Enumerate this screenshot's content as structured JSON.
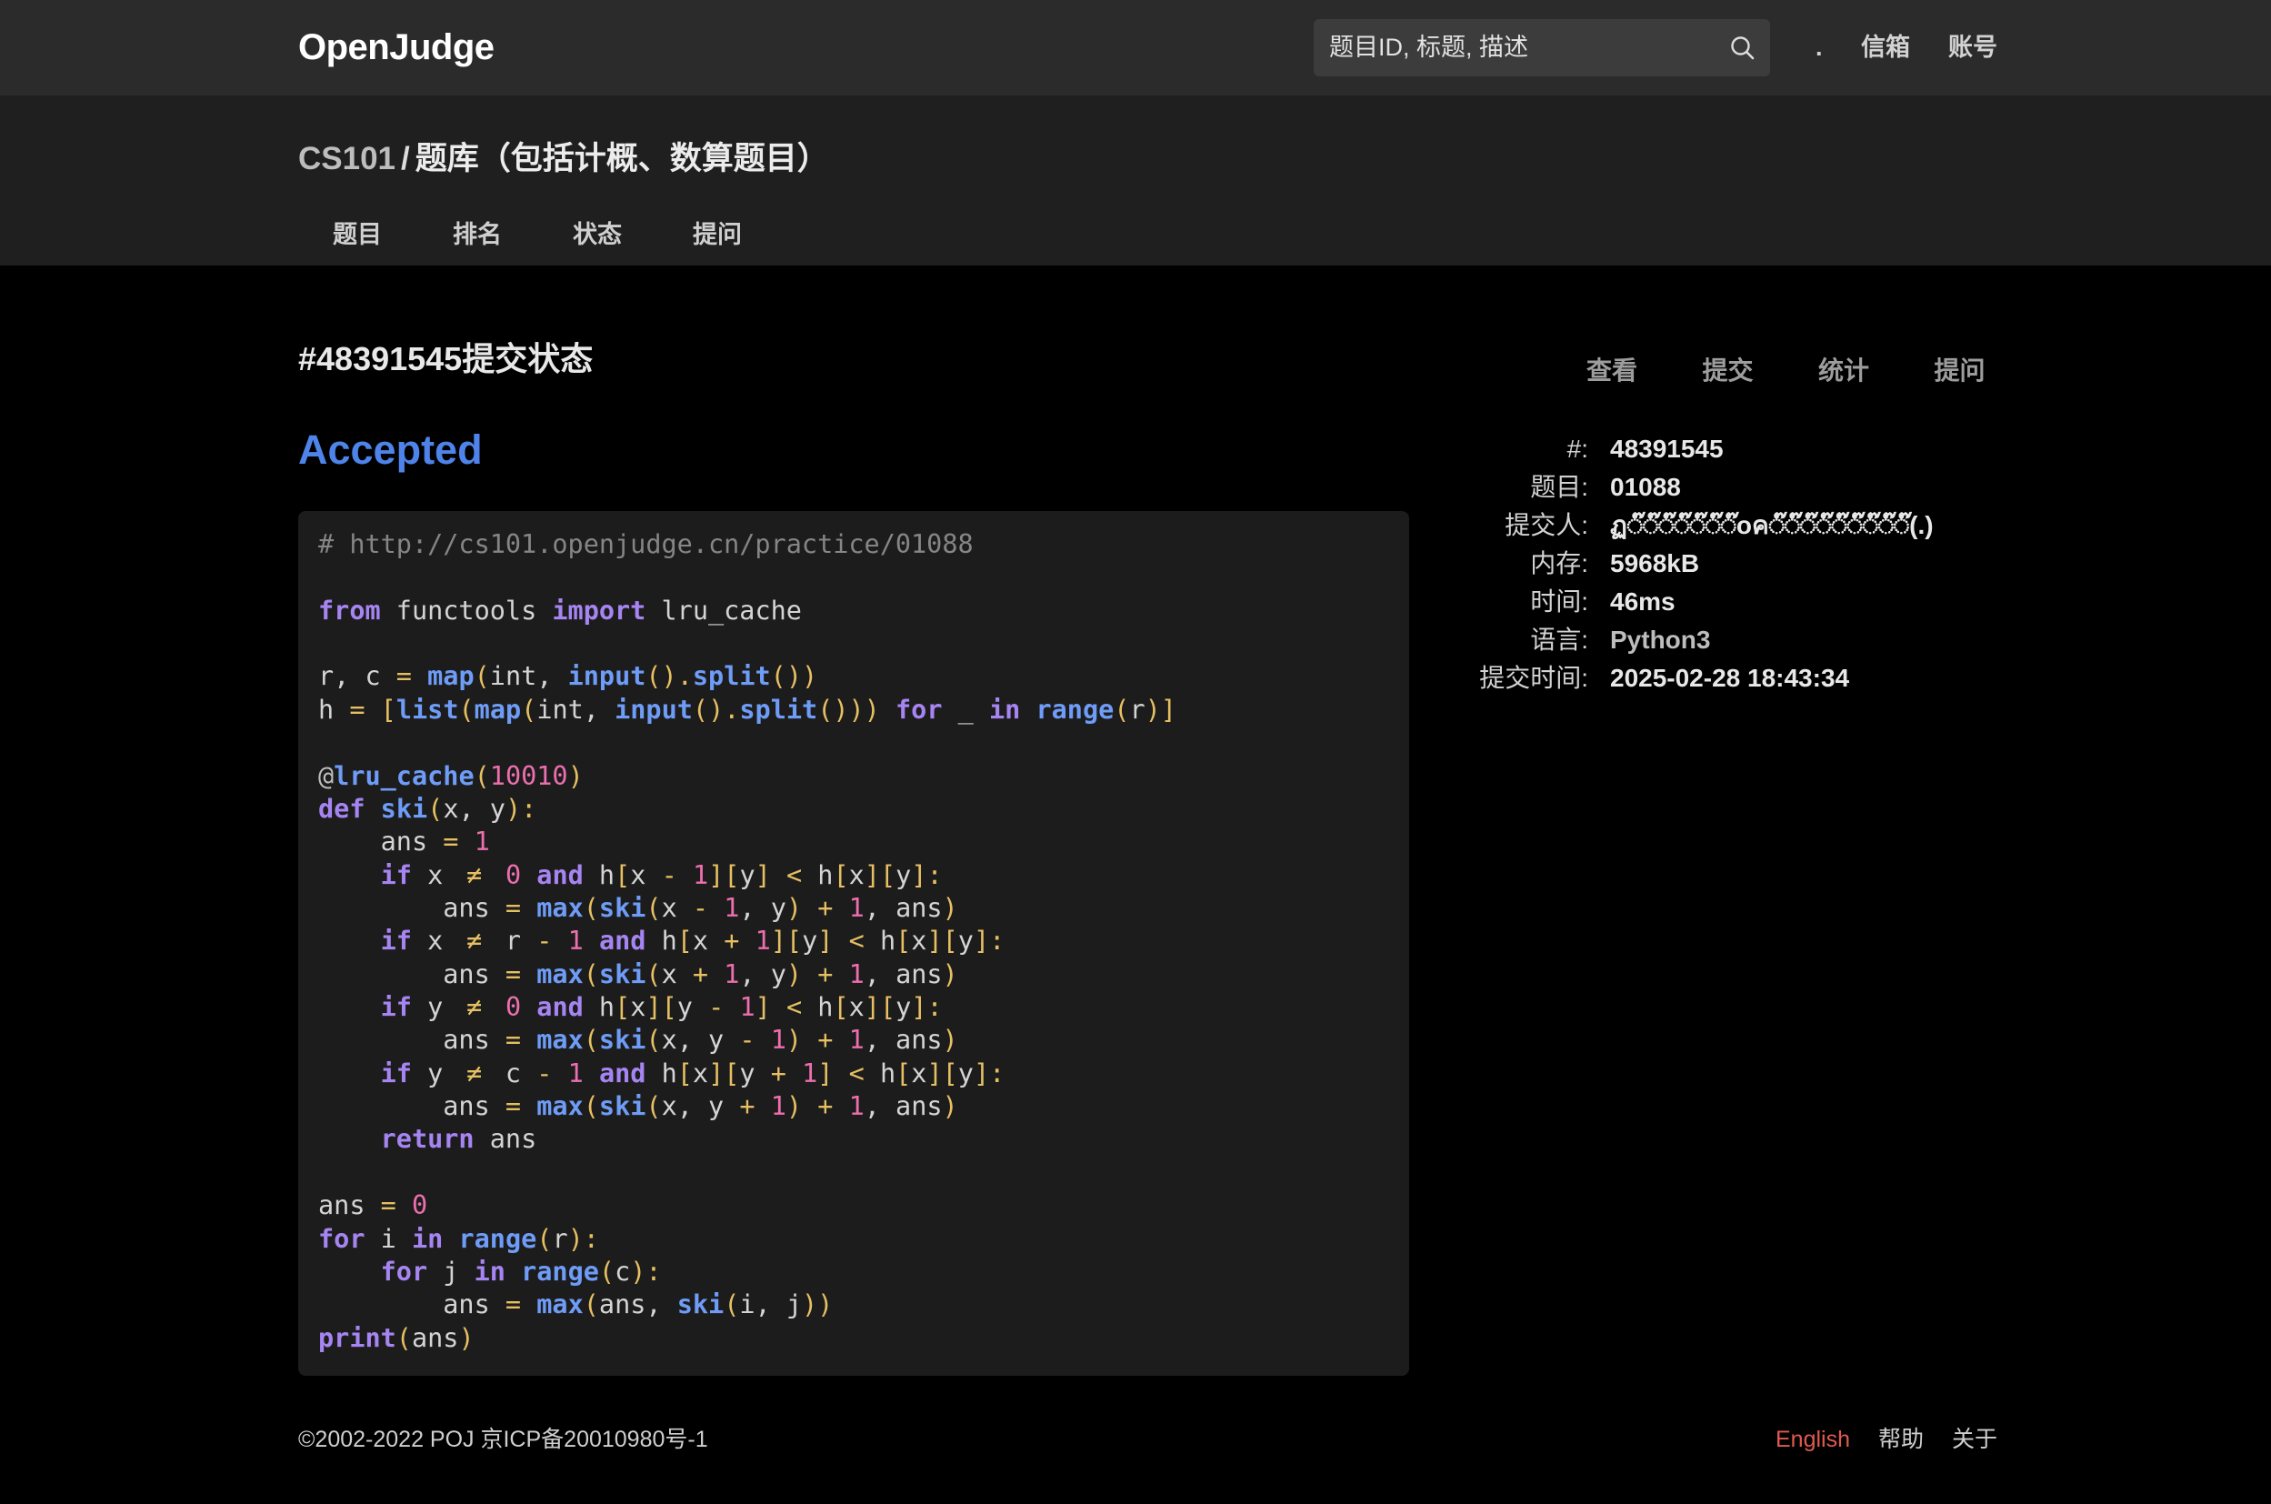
{
  "header": {
    "logo": "OpenJudge",
    "search": {
      "placeholder": "题目ID, 标题, 描述",
      "value": "",
      "icon": "search-icon"
    },
    "nav": {
      "dot": ".",
      "inbox": "信箱",
      "account": "账号"
    }
  },
  "subheader": {
    "course": "CS101",
    "separator": "/",
    "bank": "题库（包括计概、数算题目）",
    "tabs": [
      "题目",
      "排名",
      "状态",
      "提问"
    ]
  },
  "submission": {
    "title": "#48391545提交状态",
    "status": "Accepted"
  },
  "sidebar": {
    "tabs": [
      "查看",
      "提交",
      "统计",
      "提问"
    ],
    "info": [
      {
        "label": "#:",
        "value": "48391545"
      },
      {
        "label": "题目:",
        "value": "01088"
      },
      {
        "label": "提交人:",
        "value": "ฏ◌๊◌๊◌๊◌๊◌๊◌๊◌๊oค◌๊◌๊◌๊◌๊◌๊◌๊◌๊◌๊◌๊(.)"
      },
      {
        "label": "内存:",
        "value": "5968kB"
      },
      {
        "label": "时间:",
        "value": "46ms"
      },
      {
        "label": "语言:",
        "value": "Python3"
      },
      {
        "label": "提交时间:",
        "value": "2025-02-28 18:43:34"
      }
    ]
  },
  "colors": {
    "status_accepted": "#4e84ea",
    "english_link": "#e05a4e",
    "keyword": "#a685f2",
    "builtin": "#6e9cf7",
    "number": "#ec6fae",
    "operator": "#e6bf62",
    "plain": "#d4d4d4",
    "comment": "#858585",
    "decorator": "#bdbdbd"
  },
  "code": {
    "lines": [
      [
        [
          "# http://cs101.openjudge.cn/practice/01088",
          "#858585"
        ]
      ],
      [],
      [
        [
          "from",
          "#a685f2"
        ],
        [
          " functools ",
          "#d4d4d4"
        ],
        [
          "import",
          "#a685f2"
        ],
        [
          " lru_cache",
          "#d4d4d4"
        ]
      ],
      [],
      [
        [
          "r, c ",
          "#d4d4d4"
        ],
        [
          "=",
          "#e6bf62"
        ],
        [
          " ",
          "#d4d4d4"
        ],
        [
          "map",
          "#6e9cf7"
        ],
        [
          "(",
          "#e6bf62"
        ],
        [
          "int, ",
          "#d4d4d4"
        ],
        [
          "input",
          "#6e9cf7"
        ],
        [
          "().",
          "#e6bf62"
        ],
        [
          "split",
          "#6e9cf7"
        ],
        [
          "())",
          "#e6bf62"
        ]
      ],
      [
        [
          "h ",
          "#d4d4d4"
        ],
        [
          "=",
          "#e6bf62"
        ],
        [
          " ",
          "#d4d4d4"
        ],
        [
          "[",
          "#e6bf62"
        ],
        [
          "list",
          "#6e9cf7"
        ],
        [
          "(",
          "#e6bf62"
        ],
        [
          "map",
          "#6e9cf7"
        ],
        [
          "(",
          "#e6bf62"
        ],
        [
          "int, ",
          "#d4d4d4"
        ],
        [
          "input",
          "#6e9cf7"
        ],
        [
          "().",
          "#e6bf62"
        ],
        [
          "split",
          "#6e9cf7"
        ],
        [
          "()))",
          "#e6bf62"
        ],
        [
          " ",
          "#d4d4d4"
        ],
        [
          "for",
          "#a685f2"
        ],
        [
          " _ ",
          "#d4d4d4"
        ],
        [
          "in",
          "#a685f2"
        ],
        [
          " ",
          "#d4d4d4"
        ],
        [
          "range",
          "#6e9cf7"
        ],
        [
          "(",
          "#e6bf62"
        ],
        [
          "r",
          "#d4d4d4"
        ],
        [
          ")]",
          "#e6bf62"
        ]
      ],
      [],
      [
        [
          "@",
          "#bdbdbd"
        ],
        [
          "lru_cache",
          "#6e9cf7"
        ],
        [
          "(",
          "#e6bf62"
        ],
        [
          "10010",
          "#ec6fae"
        ],
        [
          ")",
          "#e6bf62"
        ]
      ],
      [
        [
          "def",
          "#a685f2"
        ],
        [
          " ",
          "#d4d4d4"
        ],
        [
          "ski",
          "#6e9cf7"
        ],
        [
          "(",
          "#e6bf62"
        ],
        [
          "x, y",
          "#d4d4d4"
        ],
        [
          "):",
          "#e6bf62"
        ]
      ],
      [
        [
          "    ans ",
          "#d4d4d4"
        ],
        [
          "=",
          "#e6bf62"
        ],
        [
          " ",
          "#d4d4d4"
        ],
        [
          "1",
          "#ec6fae"
        ]
      ],
      [
        [
          "    ",
          "#d4d4d4"
        ],
        [
          "if",
          "#a685f2"
        ],
        [
          " x ",
          "#d4d4d4"
        ],
        [
          "≠",
          "#e6bf62"
        ],
        [
          " ",
          "#d4d4d4"
        ],
        [
          "0",
          "#ec6fae"
        ],
        [
          " ",
          "#d4d4d4"
        ],
        [
          "and",
          "#a685f2"
        ],
        [
          " h",
          "#d4d4d4"
        ],
        [
          "[",
          "#e6bf62"
        ],
        [
          "x ",
          "#d4d4d4"
        ],
        [
          "-",
          "#e6bf62"
        ],
        [
          " ",
          "#d4d4d4"
        ],
        [
          "1",
          "#ec6fae"
        ],
        [
          "][",
          "#e6bf62"
        ],
        [
          "y",
          "#d4d4d4"
        ],
        [
          "]",
          "#e6bf62"
        ],
        [
          " ",
          "#d4d4d4"
        ],
        [
          "<",
          "#e6bf62"
        ],
        [
          " h",
          "#d4d4d4"
        ],
        [
          "[",
          "#e6bf62"
        ],
        [
          "x",
          "#d4d4d4"
        ],
        [
          "][",
          "#e6bf62"
        ],
        [
          "y",
          "#d4d4d4"
        ],
        [
          "]:",
          "#e6bf62"
        ]
      ],
      [
        [
          "        ans ",
          "#d4d4d4"
        ],
        [
          "=",
          "#e6bf62"
        ],
        [
          " ",
          "#d4d4d4"
        ],
        [
          "max",
          "#6e9cf7"
        ],
        [
          "(",
          "#e6bf62"
        ],
        [
          "ski",
          "#6e9cf7"
        ],
        [
          "(",
          "#e6bf62"
        ],
        [
          "x ",
          "#d4d4d4"
        ],
        [
          "-",
          "#e6bf62"
        ],
        [
          " ",
          "#d4d4d4"
        ],
        [
          "1",
          "#ec6fae"
        ],
        [
          ", y",
          "#d4d4d4"
        ],
        [
          ")",
          "#e6bf62"
        ],
        [
          " ",
          "#d4d4d4"
        ],
        [
          "+",
          "#e6bf62"
        ],
        [
          " ",
          "#d4d4d4"
        ],
        [
          "1",
          "#ec6fae"
        ],
        [
          ", ans",
          "#d4d4d4"
        ],
        [
          ")",
          "#e6bf62"
        ]
      ],
      [
        [
          "    ",
          "#d4d4d4"
        ],
        [
          "if",
          "#a685f2"
        ],
        [
          " x ",
          "#d4d4d4"
        ],
        [
          "≠",
          "#e6bf62"
        ],
        [
          " r ",
          "#d4d4d4"
        ],
        [
          "-",
          "#e6bf62"
        ],
        [
          " ",
          "#d4d4d4"
        ],
        [
          "1",
          "#ec6fae"
        ],
        [
          " ",
          "#d4d4d4"
        ],
        [
          "and",
          "#a685f2"
        ],
        [
          " h",
          "#d4d4d4"
        ],
        [
          "[",
          "#e6bf62"
        ],
        [
          "x ",
          "#d4d4d4"
        ],
        [
          "+",
          "#e6bf62"
        ],
        [
          " ",
          "#d4d4d4"
        ],
        [
          "1",
          "#ec6fae"
        ],
        [
          "][",
          "#e6bf62"
        ],
        [
          "y",
          "#d4d4d4"
        ],
        [
          "]",
          "#e6bf62"
        ],
        [
          " ",
          "#d4d4d4"
        ],
        [
          "<",
          "#e6bf62"
        ],
        [
          " h",
          "#d4d4d4"
        ],
        [
          "[",
          "#e6bf62"
        ],
        [
          "x",
          "#d4d4d4"
        ],
        [
          "][",
          "#e6bf62"
        ],
        [
          "y",
          "#d4d4d4"
        ],
        [
          "]:",
          "#e6bf62"
        ]
      ],
      [
        [
          "        ans ",
          "#d4d4d4"
        ],
        [
          "=",
          "#e6bf62"
        ],
        [
          " ",
          "#d4d4d4"
        ],
        [
          "max",
          "#6e9cf7"
        ],
        [
          "(",
          "#e6bf62"
        ],
        [
          "ski",
          "#6e9cf7"
        ],
        [
          "(",
          "#e6bf62"
        ],
        [
          "x ",
          "#d4d4d4"
        ],
        [
          "+",
          "#e6bf62"
        ],
        [
          " ",
          "#d4d4d4"
        ],
        [
          "1",
          "#ec6fae"
        ],
        [
          ", y",
          "#d4d4d4"
        ],
        [
          ")",
          "#e6bf62"
        ],
        [
          " ",
          "#d4d4d4"
        ],
        [
          "+",
          "#e6bf62"
        ],
        [
          " ",
          "#d4d4d4"
        ],
        [
          "1",
          "#ec6fae"
        ],
        [
          ", ans",
          "#d4d4d4"
        ],
        [
          ")",
          "#e6bf62"
        ]
      ],
      [
        [
          "    ",
          "#d4d4d4"
        ],
        [
          "if",
          "#a685f2"
        ],
        [
          " y ",
          "#d4d4d4"
        ],
        [
          "≠",
          "#e6bf62"
        ],
        [
          " ",
          "#d4d4d4"
        ],
        [
          "0",
          "#ec6fae"
        ],
        [
          " ",
          "#d4d4d4"
        ],
        [
          "and",
          "#a685f2"
        ],
        [
          " h",
          "#d4d4d4"
        ],
        [
          "[",
          "#e6bf62"
        ],
        [
          "x",
          "#d4d4d4"
        ],
        [
          "][",
          "#e6bf62"
        ],
        [
          "y ",
          "#d4d4d4"
        ],
        [
          "-",
          "#e6bf62"
        ],
        [
          " ",
          "#d4d4d4"
        ],
        [
          "1",
          "#ec6fae"
        ],
        [
          "]",
          "#e6bf62"
        ],
        [
          " ",
          "#d4d4d4"
        ],
        [
          "<",
          "#e6bf62"
        ],
        [
          " h",
          "#d4d4d4"
        ],
        [
          "[",
          "#e6bf62"
        ],
        [
          "x",
          "#d4d4d4"
        ],
        [
          "][",
          "#e6bf62"
        ],
        [
          "y",
          "#d4d4d4"
        ],
        [
          "]:",
          "#e6bf62"
        ]
      ],
      [
        [
          "        ans ",
          "#d4d4d4"
        ],
        [
          "=",
          "#e6bf62"
        ],
        [
          " ",
          "#d4d4d4"
        ],
        [
          "max",
          "#6e9cf7"
        ],
        [
          "(",
          "#e6bf62"
        ],
        [
          "ski",
          "#6e9cf7"
        ],
        [
          "(",
          "#e6bf62"
        ],
        [
          "x, y ",
          "#d4d4d4"
        ],
        [
          "-",
          "#e6bf62"
        ],
        [
          " ",
          "#d4d4d4"
        ],
        [
          "1",
          "#ec6fae"
        ],
        [
          ")",
          "#e6bf62"
        ],
        [
          " ",
          "#d4d4d4"
        ],
        [
          "+",
          "#e6bf62"
        ],
        [
          " ",
          "#d4d4d4"
        ],
        [
          "1",
          "#ec6fae"
        ],
        [
          ", ans",
          "#d4d4d4"
        ],
        [
          ")",
          "#e6bf62"
        ]
      ],
      [
        [
          "    ",
          "#d4d4d4"
        ],
        [
          "if",
          "#a685f2"
        ],
        [
          " y ",
          "#d4d4d4"
        ],
        [
          "≠",
          "#e6bf62"
        ],
        [
          " c ",
          "#d4d4d4"
        ],
        [
          "-",
          "#e6bf62"
        ],
        [
          " ",
          "#d4d4d4"
        ],
        [
          "1",
          "#ec6fae"
        ],
        [
          " ",
          "#d4d4d4"
        ],
        [
          "and",
          "#a685f2"
        ],
        [
          " h",
          "#d4d4d4"
        ],
        [
          "[",
          "#e6bf62"
        ],
        [
          "x",
          "#d4d4d4"
        ],
        [
          "][",
          "#e6bf62"
        ],
        [
          "y ",
          "#d4d4d4"
        ],
        [
          "+",
          "#e6bf62"
        ],
        [
          " ",
          "#d4d4d4"
        ],
        [
          "1",
          "#ec6fae"
        ],
        [
          "]",
          "#e6bf62"
        ],
        [
          " ",
          "#d4d4d4"
        ],
        [
          "<",
          "#e6bf62"
        ],
        [
          " h",
          "#d4d4d4"
        ],
        [
          "[",
          "#e6bf62"
        ],
        [
          "x",
          "#d4d4d4"
        ],
        [
          "][",
          "#e6bf62"
        ],
        [
          "y",
          "#d4d4d4"
        ],
        [
          "]:",
          "#e6bf62"
        ]
      ],
      [
        [
          "        ans ",
          "#d4d4d4"
        ],
        [
          "=",
          "#e6bf62"
        ],
        [
          " ",
          "#d4d4d4"
        ],
        [
          "max",
          "#6e9cf7"
        ],
        [
          "(",
          "#e6bf62"
        ],
        [
          "ski",
          "#6e9cf7"
        ],
        [
          "(",
          "#e6bf62"
        ],
        [
          "x, y ",
          "#d4d4d4"
        ],
        [
          "+",
          "#e6bf62"
        ],
        [
          " ",
          "#d4d4d4"
        ],
        [
          "1",
          "#ec6fae"
        ],
        [
          ")",
          "#e6bf62"
        ],
        [
          " ",
          "#d4d4d4"
        ],
        [
          "+",
          "#e6bf62"
        ],
        [
          " ",
          "#d4d4d4"
        ],
        [
          "1",
          "#ec6fae"
        ],
        [
          ", ans",
          "#d4d4d4"
        ],
        [
          ")",
          "#e6bf62"
        ]
      ],
      [
        [
          "    ",
          "#d4d4d4"
        ],
        [
          "return",
          "#a685f2"
        ],
        [
          " ans",
          "#d4d4d4"
        ]
      ],
      [],
      [
        [
          "ans ",
          "#d4d4d4"
        ],
        [
          "=",
          "#e6bf62"
        ],
        [
          " ",
          "#d4d4d4"
        ],
        [
          "0",
          "#ec6fae"
        ]
      ],
      [
        [
          "for",
          "#a685f2"
        ],
        [
          " i ",
          "#d4d4d4"
        ],
        [
          "in",
          "#a685f2"
        ],
        [
          " ",
          "#d4d4d4"
        ],
        [
          "range",
          "#6e9cf7"
        ],
        [
          "(",
          "#e6bf62"
        ],
        [
          "r",
          "#d4d4d4"
        ],
        [
          "):",
          "#e6bf62"
        ]
      ],
      [
        [
          "    ",
          "#d4d4d4"
        ],
        [
          "for",
          "#a685f2"
        ],
        [
          " j ",
          "#d4d4d4"
        ],
        [
          "in",
          "#a685f2"
        ],
        [
          " ",
          "#d4d4d4"
        ],
        [
          "range",
          "#6e9cf7"
        ],
        [
          "(",
          "#e6bf62"
        ],
        [
          "c",
          "#d4d4d4"
        ],
        [
          "):",
          "#e6bf62"
        ]
      ],
      [
        [
          "        ans ",
          "#d4d4d4"
        ],
        [
          "=",
          "#e6bf62"
        ],
        [
          " ",
          "#d4d4d4"
        ],
        [
          "max",
          "#6e9cf7"
        ],
        [
          "(",
          "#e6bf62"
        ],
        [
          "ans, ",
          "#d4d4d4"
        ],
        [
          "ski",
          "#6e9cf7"
        ],
        [
          "(",
          "#e6bf62"
        ],
        [
          "i, j",
          "#d4d4d4"
        ],
        [
          "))",
          "#e6bf62"
        ]
      ],
      [
        [
          "print",
          "#a685f2"
        ],
        [
          "(",
          "#e6bf62"
        ],
        [
          "ans",
          "#d4d4d4"
        ],
        [
          ")",
          "#e6bf62"
        ]
      ]
    ]
  },
  "footer": {
    "copyright": "©2002-2022 POJ 京ICP备20010980号-1",
    "links": {
      "english": "English",
      "help": "帮助",
      "about": "关于"
    }
  }
}
